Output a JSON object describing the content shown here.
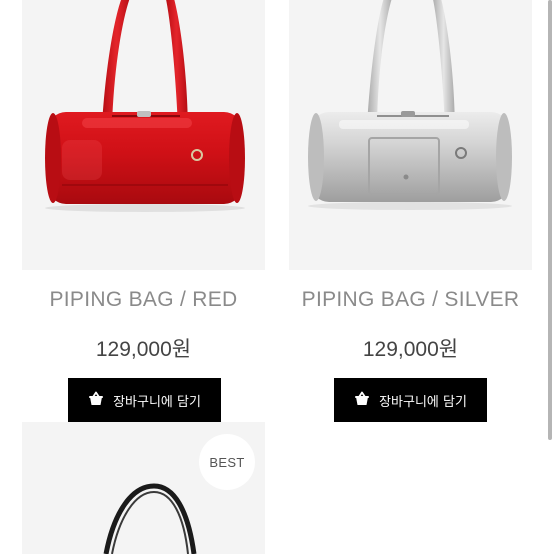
{
  "products": [
    {
      "name": "PIPING BAG / RED",
      "price": "129,000원",
      "cart_label": "장바구니에 담기",
      "color": "#d10f17",
      "image_icon": "red-duffel-bag-image"
    },
    {
      "name": "PIPING BAG / SILVER",
      "price": "129,000원",
      "cart_label": "장바구니에 담기",
      "color": "#c9c9c9",
      "image_icon": "silver-duffel-bag-image"
    },
    {
      "badge": "BEST",
      "image_icon": "black-tote-bag-image"
    }
  ],
  "colors": {
    "button_bg": "#000000",
    "button_text": "#ffffff",
    "name_text": "#8a8a8a",
    "price_text": "#444444",
    "image_bg": "#f4f4f4"
  },
  "icons": {
    "cart": "shopping-basket-icon"
  }
}
